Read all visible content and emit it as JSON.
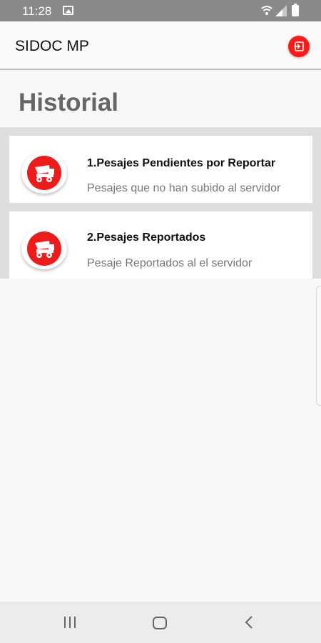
{
  "status_bar": {
    "time": "11:28",
    "icons": [
      "gallery-icon",
      "wifi-icon",
      "signal-icon",
      "battery-icon"
    ]
  },
  "app_bar": {
    "title": "SIDOC MP",
    "action_icon": "logout-icon",
    "accent_color": "#ff1a1a"
  },
  "page": {
    "heading": "Historial"
  },
  "items": [
    {
      "title": "1.Pesajes Pendientes por Reportar",
      "subtitle": "Pesajes que no han subido al servidor",
      "icon": "truck-icon"
    },
    {
      "title": "2.Pesajes Reportados",
      "subtitle": "Pesaje Reportados al el servidor",
      "icon": "truck-icon"
    }
  ],
  "navigation_bar": {
    "buttons": [
      "recents-icon",
      "home-icon",
      "back-icon"
    ]
  }
}
